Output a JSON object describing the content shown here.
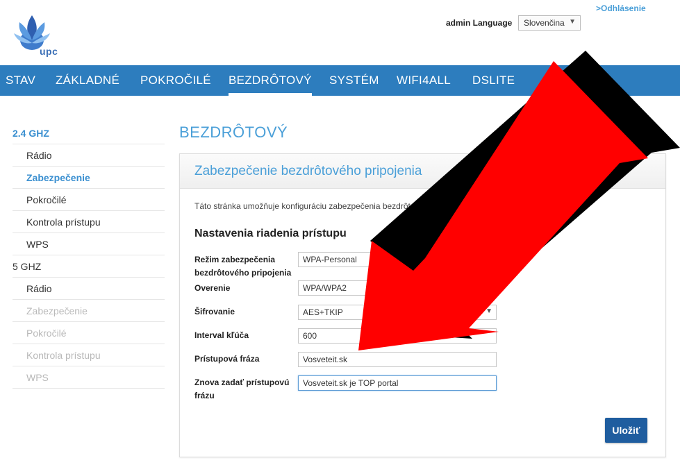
{
  "header": {
    "logo_text": "upc",
    "logout_label": ">Odhlásenie",
    "lang_label": "admin Language",
    "lang_value": "Slovenčina"
  },
  "nav": {
    "items": [
      {
        "label": "STAV"
      },
      {
        "label": "ZÁKLADNÉ"
      },
      {
        "label": "POKROČILÉ"
      },
      {
        "label": "BEZDRÔTOVÝ"
      },
      {
        "label": "SYSTÉM"
      },
      {
        "label": "WIFI4ALL"
      },
      {
        "label": "DSLITE"
      }
    ],
    "active": "BEZDRÔTOVÝ"
  },
  "sidebar": {
    "group1": "2.4 GHZ",
    "group1_items": [
      "Rádio",
      "Zabezpečenie",
      "Pokročilé",
      "Kontrola prístupu",
      "WPS"
    ],
    "group2": "5 GHZ",
    "group2_items": [
      "Rádio",
      "Zabezpečenie",
      "Pokročilé",
      "Kontrola prístupu",
      "WPS"
    ]
  },
  "page": {
    "title": "BEZDRÔTOVÝ",
    "panel_title": "Zabezpečenie bezdrôtového pripojenia",
    "description": "Táto stránka umožňuje konfiguráciu zabezpečenia bezdrôtového pri",
    "section_title": "Nastavenia riadenia prístupu",
    "fields": {
      "mode_label_1": "Režim zabezpečenia",
      "mode_label_2": "bezdrôtového pripojenia",
      "mode_value": "WPA-Personal",
      "auth_label": "Overenie",
      "auth_value": "WPA/WPA2",
      "enc_label": "Šifrovanie",
      "enc_value": "AES+TKIP",
      "interval_label": "Interval kľúča",
      "interval_value": "600",
      "pass_label": "Prístupová fráza",
      "pass_value": "Vosveteit.sk",
      "repass_label_1": "Znova zadať prístupovú",
      "repass_label_2": "frázu",
      "repass_value": "Vosveteit.sk je TOP portal"
    },
    "save_label": "Uložiť"
  },
  "colors": {
    "nav_bg": "#2d7dbe",
    "accent": "#4a9fd8",
    "save_bg": "#1f5d9f",
    "arrow_red": "#ff0000"
  }
}
